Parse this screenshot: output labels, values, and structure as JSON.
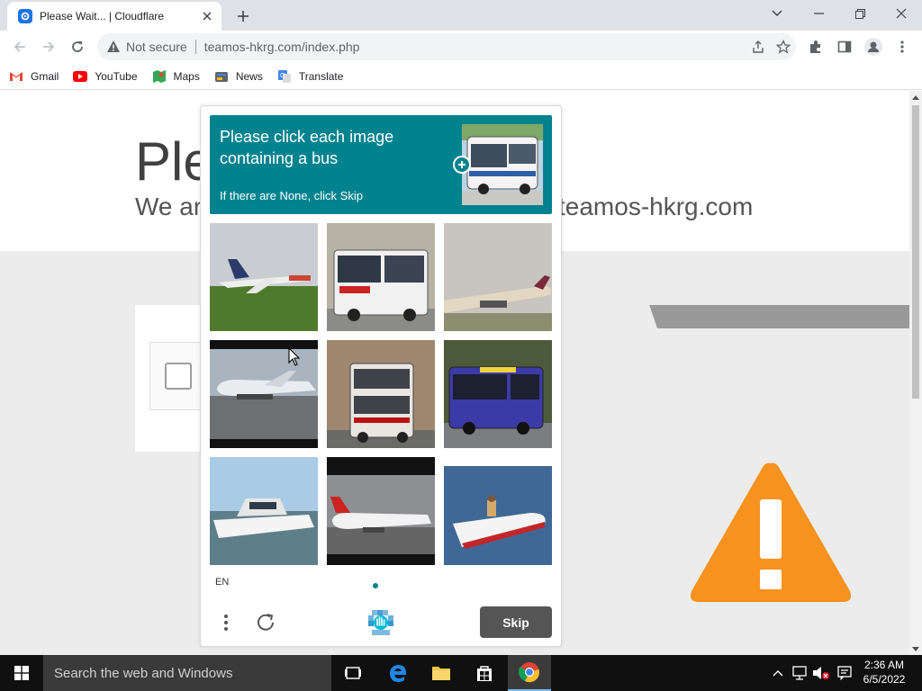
{
  "browser": {
    "tab_title": "Please Wait... | Cloudflare",
    "security_label": "Not secure",
    "url": "teamos-hkrg.com/index.php",
    "bookmarks": [
      {
        "label": "Gmail",
        "icon": "gmail-icon"
      },
      {
        "label": "YouTube",
        "icon": "youtube-icon"
      },
      {
        "label": "Maps",
        "icon": "maps-icon"
      },
      {
        "label": "News",
        "icon": "news-icon"
      },
      {
        "label": "Translate",
        "icon": "translate-icon"
      }
    ]
  },
  "page": {
    "title": "Ple",
    "subtitle": "We ar",
    "domain": "teamos-hkrg.com"
  },
  "captcha": {
    "prompt": "Please click each image containing a bus",
    "hint": "If there are None, click Skip",
    "language": "EN",
    "skip_label": "Skip",
    "accent_color": "#00838f",
    "tiles": [
      {
        "content": "airplane"
      },
      {
        "content": "bus"
      },
      {
        "content": "airplane"
      },
      {
        "content": "airplane"
      },
      {
        "content": "double-decker bus"
      },
      {
        "content": "bus"
      },
      {
        "content": "boat"
      },
      {
        "content": "airplane"
      },
      {
        "content": "speedboat"
      }
    ]
  },
  "taskbar": {
    "search_placeholder": "Search the web and Windows",
    "time": "2:36 AM",
    "date": "6/5/2022"
  }
}
